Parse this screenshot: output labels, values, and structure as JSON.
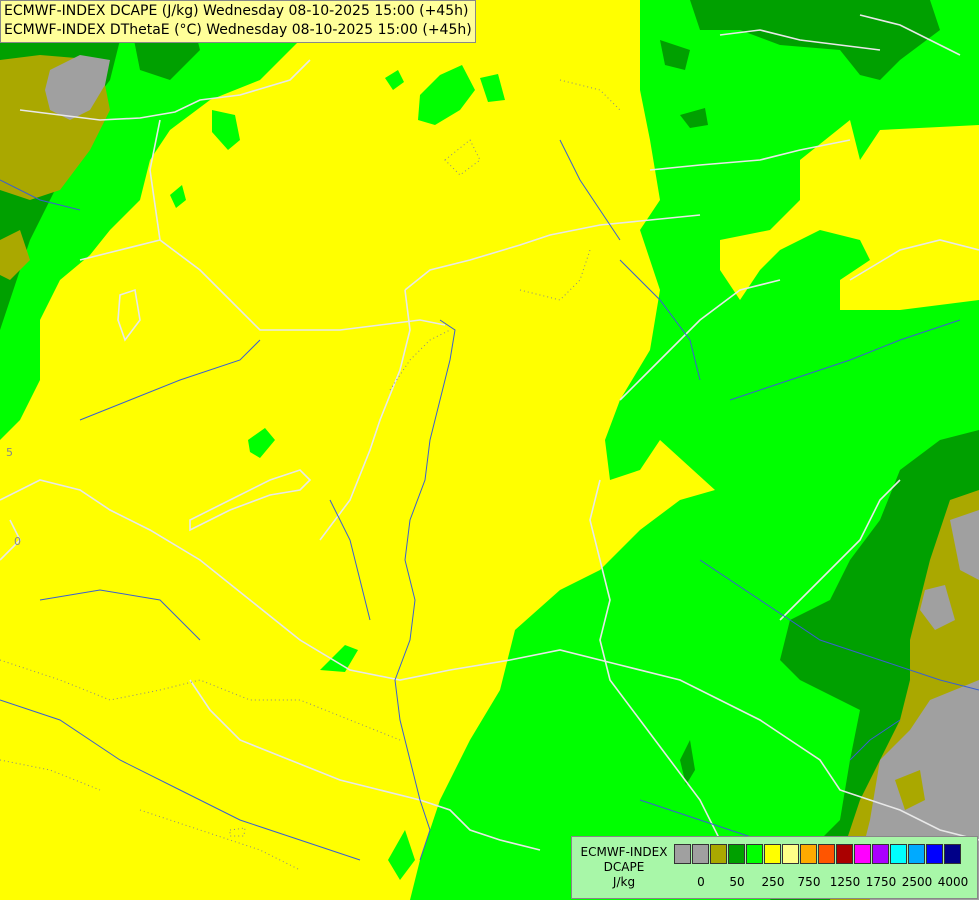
{
  "header": {
    "line1": "ECMWF-INDEX DCAPE (J/kg) Wednesday 08-10-2025 15:00 (+45h)",
    "line2": "ECMWF-INDEX DThetaE (°C) Wednesday 08-10-2025 15:00 (+45h)"
  },
  "legend": {
    "line1": "ECMWF-INDEX",
    "line2": "DCAPE",
    "line3": "J/kg",
    "colors": [
      "#a0a0a0",
      "#a0a0a0",
      "#aaa800",
      "#00a000",
      "#00ff00",
      "#ffff00",
      "#ffff88",
      "#ffaa00",
      "#ff5500",
      "#aa0000",
      "#ff00ff",
      "#aa00ff",
      "#00ffff",
      "#00aaff",
      "#0000ff",
      "#000088"
    ],
    "ticks": [
      "0",
      "50",
      "250",
      "750",
      "1250",
      "1750",
      "2500",
      "4000"
    ],
    "tick_boundaries": [
      1,
      3,
      5,
      7,
      9,
      11,
      13,
      15
    ]
  },
  "map_colors": {
    "gray": "#a0a0a0",
    "olive": "#aaa800",
    "dark_green": "#00a000",
    "bright_green": "#00ff00",
    "yellow": "#ffff00",
    "border": "#e8e8e8",
    "river": "#3a5fd0",
    "contour": "#888888"
  },
  "contour_labels": [
    "5",
    "0"
  ]
}
